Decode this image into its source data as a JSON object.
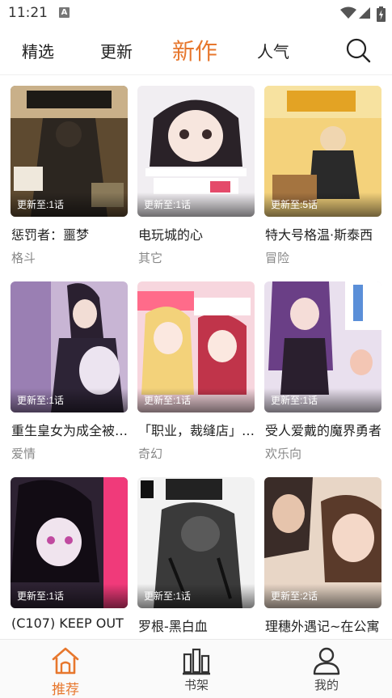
{
  "status_bar": {
    "time": "11:21",
    "notification_glyph": "A"
  },
  "top_tabs": [
    {
      "label": "精选"
    },
    {
      "label": "更新"
    },
    {
      "label": "新作"
    },
    {
      "label": "人气"
    }
  ],
  "active_tab": "新作",
  "cards": [
    {
      "title": "惩罚者：噩梦",
      "genre": "格斗",
      "update": "更新至:1话",
      "cover_color": "#6b5a3c"
    },
    {
      "title": "电玩城的心",
      "genre": "其它",
      "update": "更新至:1话",
      "cover_color": "#e9e4ea"
    },
    {
      "title": "特大号格温·斯泰西",
      "genre": "冒险",
      "update": "更新至:5话",
      "cover_color": "#f0c86a"
    },
    {
      "title": "重生皇女为成全被诅咒的孤独公爵",
      "genre": "爱情",
      "update": "更新至:1话",
      "cover_color": "#b9a4c8"
    },
    {
      "title": "「职业，裁缝店」的VRMMO",
      "genre": "奇幻",
      "update": "更新至:1话",
      "cover_color": "#f3b4c4"
    },
    {
      "title": "受人爱戴的魔界勇者",
      "genre": "欢乐向",
      "update": "更新至:1话",
      "cover_color": "#7a5a8e"
    },
    {
      "title": "(C107) KEEP OUT",
      "genre": "",
      "update": "更新至:1话",
      "cover_color": "#3a2a3e"
    },
    {
      "title": "罗根-黑白血",
      "genre": "",
      "update": "更新至:1话",
      "cover_color": "#d8d8d8"
    },
    {
      "title": "理穗外遇记~在公寓",
      "genre": "",
      "update": "更新至:2话",
      "cover_color": "#d9b59a"
    }
  ],
  "bottom_nav": [
    {
      "label": "推荐",
      "icon": "home-icon"
    },
    {
      "label": "书架",
      "icon": "bookshelf-icon"
    },
    {
      "label": "我的",
      "icon": "user-icon"
    }
  ],
  "colors": {
    "accent": "#e7772d",
    "text": "#222222",
    "muted": "#888888"
  }
}
